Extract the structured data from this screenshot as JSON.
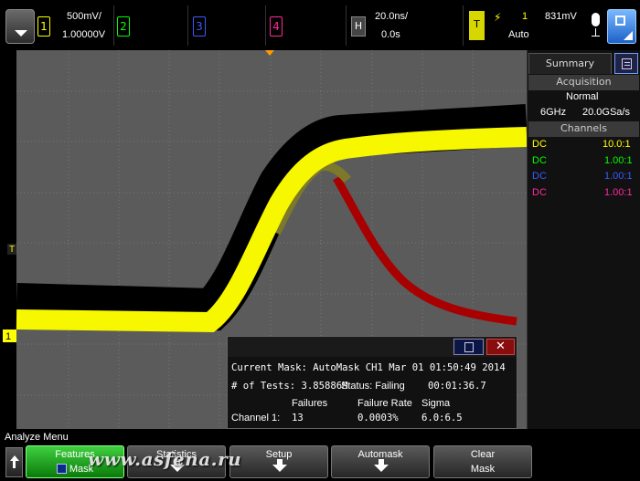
{
  "topbar": {
    "channels": [
      {
        "number": "1",
        "color": "#ffff00",
        "scale": "500mV/",
        "offset": "1.00000V"
      },
      {
        "number": "2",
        "color": "#00ff00"
      },
      {
        "number": "3",
        "color": "#3a5bff"
      },
      {
        "number": "4",
        "color": "#ff2a9a"
      }
    ],
    "horizontal": {
      "key": "H",
      "timebase": "20.0ns/",
      "delay": "0.0s"
    },
    "trigger": {
      "key": "T",
      "source": "1",
      "level": "831mV",
      "mode": "Auto"
    }
  },
  "sidepanel": {
    "tab_label": "Summary",
    "acquisition_header": "Acquisition",
    "acq_mode": "Normal",
    "bandwidth": "6GHz",
    "sample_rate": "20.0GSa/s",
    "channels_header": "Channels",
    "channel_rows": [
      {
        "coupling": "DC",
        "probe": "10.0:1",
        "color": "#ffff00"
      },
      {
        "coupling": "DC",
        "probe": "1.00:1",
        "color": "#00ff00"
      },
      {
        "coupling": "DC",
        "probe": "1.00:1",
        "color": "#3a5bff"
      },
      {
        "coupling": "DC",
        "probe": "1.00:1",
        "color": "#ff2a9a"
      }
    ]
  },
  "markers": {
    "ch1_marker": "1",
    "trigger_marker": "T"
  },
  "mask_dialog": {
    "close_glyph": "✕",
    "line1": "Current Mask: AutoMask CH1 Mar 01 01:50:49 2014",
    "tests_label": "# of Tests: 3.85886M",
    "status_label": "Status: Failing",
    "elapsed": "00:01:36.7",
    "col_failures": "Failures",
    "col_failure_rate": "Failure Rate",
    "col_sigma": "Sigma",
    "row_label": "Channel 1:",
    "row_failures": "13",
    "row_failure_rate": "0.0003%",
    "row_sigma": "6.0:6.5"
  },
  "softkeys": {
    "menu_title": "Analyze Menu",
    "keys": [
      {
        "label": "Features",
        "sub": "Mask"
      },
      {
        "label": "Statistics"
      },
      {
        "label": "Setup"
      },
      {
        "label": "Automask"
      },
      {
        "label": "Clear",
        "sub": "Mask"
      }
    ]
  },
  "watermark": "www.asfena.ru"
}
